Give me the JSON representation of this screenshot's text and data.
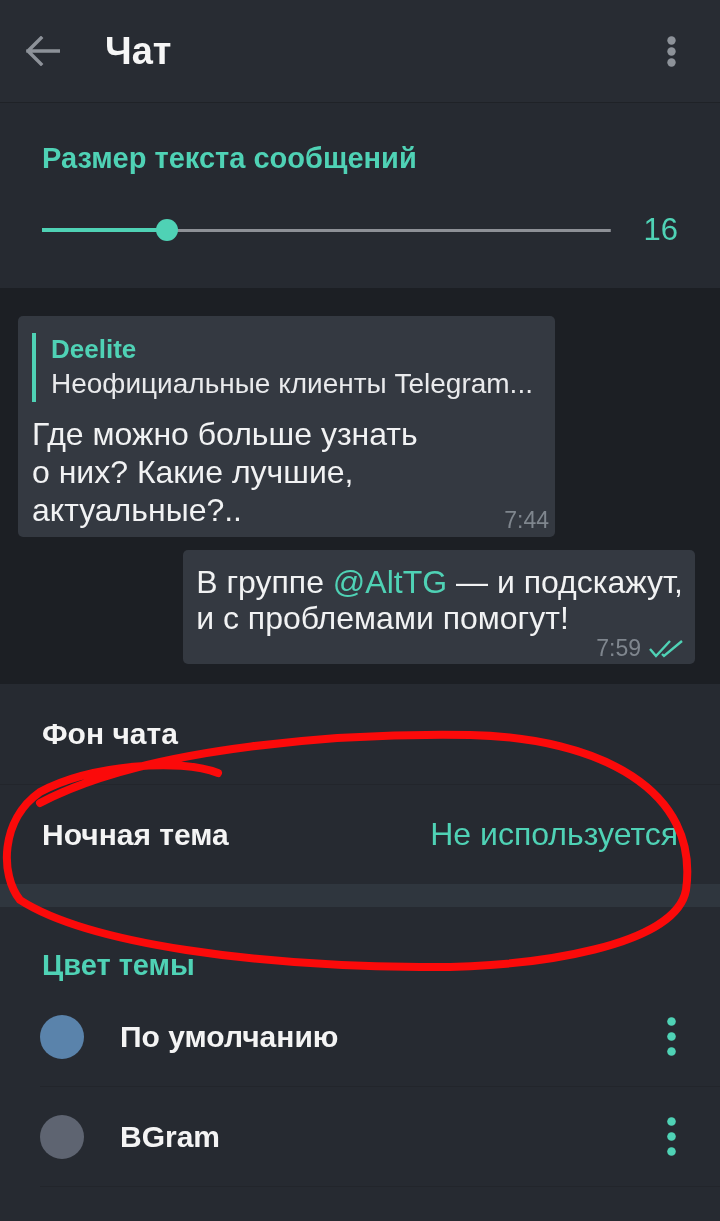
{
  "app_bar": {
    "title": "Чат"
  },
  "text_size": {
    "title": "Размер текста сообщений",
    "level": 0.22,
    "value": "16"
  },
  "preview": {
    "messages": [
      {
        "kind": "incoming",
        "reply": {
          "author": "Deelite",
          "text": "Неофициальные клиенты Telegram..."
        },
        "parts": [
          {
            "kind": "text",
            "text": "Где можно больше узнать\nо них? Какие лучшие,\nактуальные?.."
          }
        ],
        "time": "7:44"
      },
      {
        "kind": "outgoing",
        "parts": [
          {
            "kind": "text",
            "text": "В группе "
          },
          {
            "kind": "mention",
            "text": "@AltTG"
          },
          {
            "kind": "text",
            "text": " — и подскажут,\nи с проблемами помогут!"
          }
        ],
        "time": "7:59",
        "read": true
      }
    ]
  },
  "chat_settings": [
    {
      "label": "Фон чата"
    },
    {
      "label": "Ночная тема",
      "value": "Не используется"
    }
  ],
  "theme_color": {
    "title": "Цвет темы",
    "themes": [
      {
        "name": "По умолчанию",
        "color": "#5a83ab"
      },
      {
        "name": "BGram",
        "color": "#5e6471"
      }
    ]
  }
}
